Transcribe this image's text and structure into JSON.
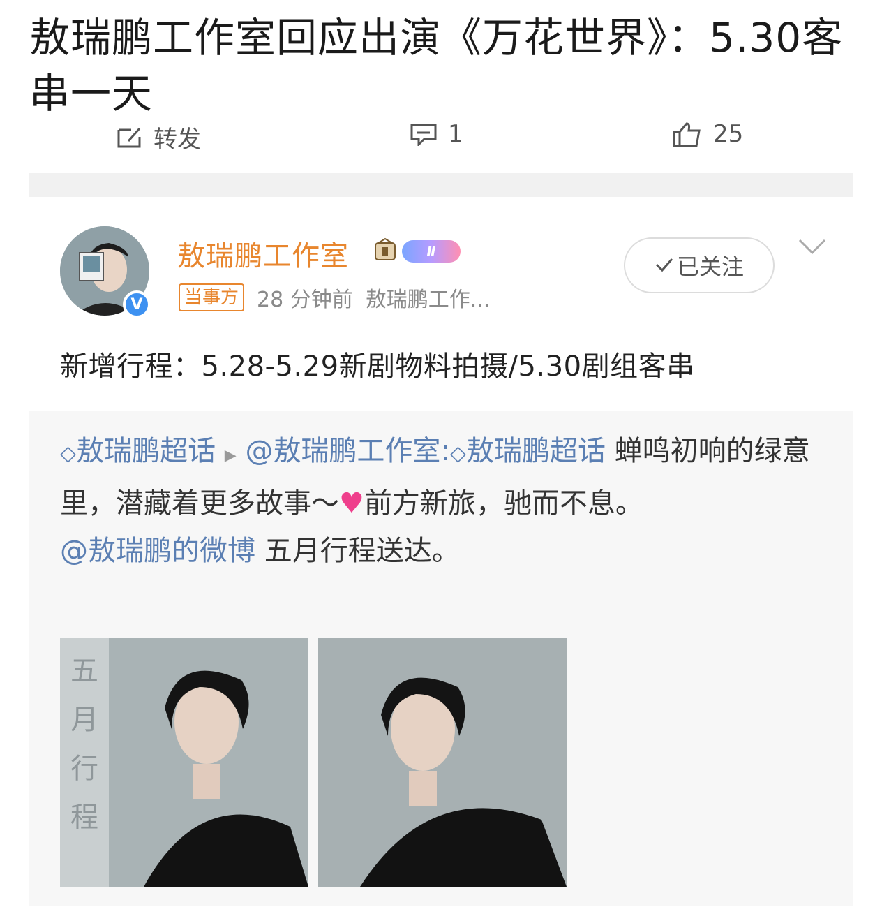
{
  "headline": "敖瑞鹏工作室回应出演《万花世界》：5.30客串一天",
  "actions": {
    "repost_label": "转发",
    "comment_count": "1",
    "like_count": "25"
  },
  "post": {
    "username": "敖瑞鹏工作室",
    "level_badge": "Ⅱ",
    "party_tag": "当事方",
    "time": "28 分钟前",
    "source": "敖瑞鹏工作...",
    "follow_label": "已关注",
    "text": "新增行程：5.28-5.29新剧物料拍摄/5.30剧组客串"
  },
  "quote": {
    "topic1": "敖瑞鹏超话",
    "mention1": "@敖瑞鹏工作室:",
    "topic2": "敖瑞鹏超话",
    "body_part1": " 蝉鸣初响的绿意里，潜藏着更多故事～",
    "body_part2": "前方新旅，驰而不息。",
    "mention2": "@敖瑞鹏的微博",
    "body_part3": " 五月行程送达。",
    "photo_caption": "五月行程"
  },
  "colors": {
    "username": "#e8862e",
    "link": "#5b7fb3",
    "verified": "#3d91f1",
    "heart": "#ef3f8c"
  },
  "icons": [
    "repost-icon",
    "comment-icon",
    "like-icon",
    "verified-icon",
    "chevron-down-icon",
    "checkmark-icon",
    "diamond-icon",
    "play-arrow-icon",
    "heart-icon"
  ]
}
